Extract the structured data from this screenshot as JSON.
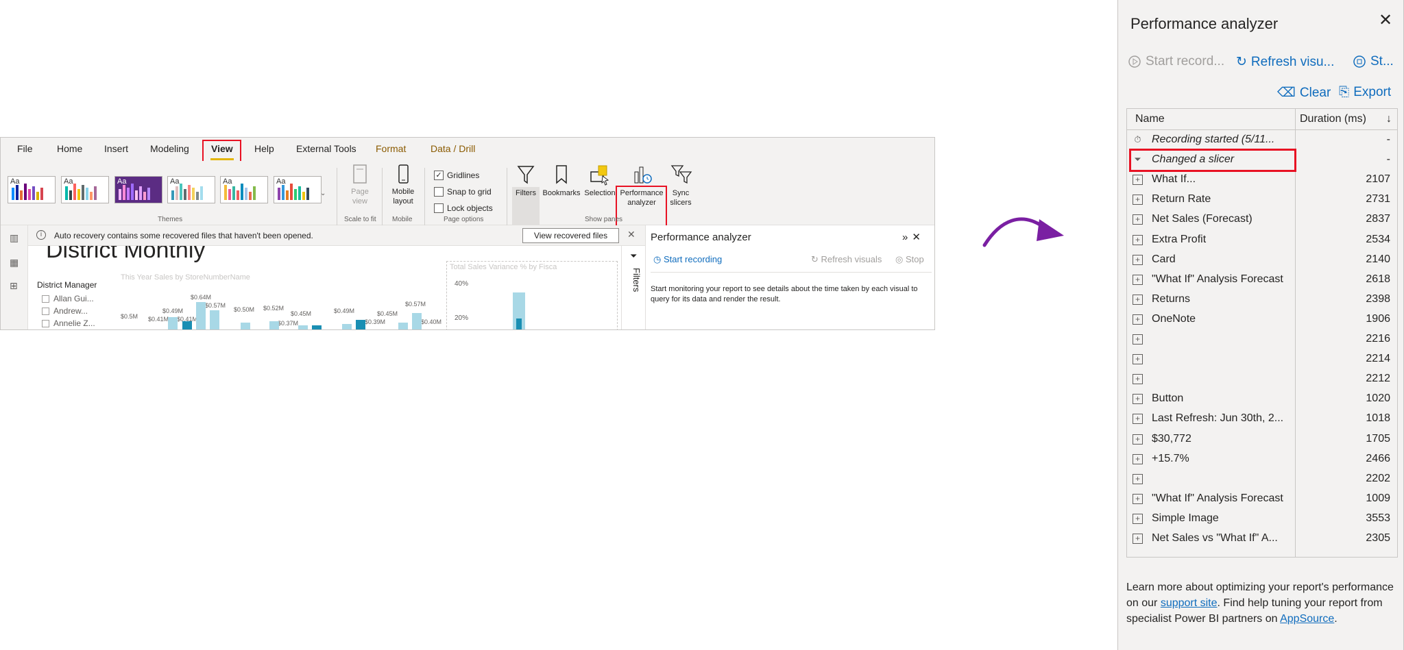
{
  "colors": {
    "accent": "#0f6cbd",
    "highlight": "#e81123",
    "tab_underline": "#e3b505",
    "arrow": "#7a1fa2"
  },
  "ribbon": {
    "menu": [
      {
        "label": "File"
      },
      {
        "label": "Home"
      },
      {
        "label": "Insert"
      },
      {
        "label": "Modeling"
      },
      {
        "label": "View"
      },
      {
        "label": "Help"
      },
      {
        "label": "External Tools"
      },
      {
        "label": "Format"
      },
      {
        "label": "Data / Drill"
      }
    ],
    "theme_aa": "Aa",
    "groups": {
      "themes": "Themes",
      "scale_to_fit": "Scale to fit",
      "mobile": "Mobile",
      "page_options": "Page options",
      "show_panes": "Show panes"
    },
    "buttons": {
      "page_view": "Page view",
      "mobile_layout": "Mobile layout",
      "filters": "Filters",
      "bookmarks": "Bookmarks",
      "selection": "Selection",
      "performance_analyzer": "Performance analyzer",
      "sync_slicers": "Sync slicers"
    },
    "checks": {
      "gridlines": "Gridlines",
      "snap_to_grid": "Snap to grid",
      "lock_objects": "Lock objects"
    }
  },
  "notice": {
    "text": "Auto recovery contains some recovered files that haven't been opened.",
    "button": "View recovered files"
  },
  "report": {
    "title": "District Monthly",
    "chart_title": "This Year Sales by StoreNumberName",
    "slicer_title": "District Manager",
    "slicer_items": [
      "Allan Gui...",
      "Andrew...",
      "Annelie Z..."
    ],
    "bar_labels": [
      "$0.64M",
      "$0.57M",
      "$0.49M",
      "$0.41M",
      "$0.41M",
      "$0.5M",
      "$0.50M",
      "$0.52M",
      "$0.45M",
      "$0.37M",
      "$0.49M",
      "$0.45M",
      "$0.39M",
      "$0.57M",
      "$0.40M"
    ],
    "chart2_title": "Total Sales Variance % by Fisca",
    "chart2_ticks": [
      "40%",
      "20%"
    ],
    "filters_tab": "Filters"
  },
  "pa_mini": {
    "title": "Performance analyzer",
    "start": "Start recording",
    "refresh": "Refresh visuals",
    "stop": "Stop",
    "description": "Start monitoring your report to see details about the time taken by each visual to query for its data and render the result."
  },
  "pa": {
    "title": "Performance analyzer",
    "start": "Start record...",
    "refresh": "Refresh visu...",
    "stop": "St...",
    "clear": "Clear",
    "export": "Export",
    "col_name": "Name",
    "col_duration": "Duration (ms)",
    "rows": [
      {
        "name": "Recording started (5/11...",
        "duration": "-",
        "kind": "timer"
      },
      {
        "name": "Changed a slicer",
        "duration": "-",
        "kind": "filter"
      },
      {
        "name": "What If...",
        "duration": "2107",
        "kind": "plus"
      },
      {
        "name": "Return Rate",
        "duration": "2731",
        "kind": "plus"
      },
      {
        "name": "Net Sales (Forecast)",
        "duration": "2837",
        "kind": "plus"
      },
      {
        "name": "Extra Profit",
        "duration": "2534",
        "kind": "plus"
      },
      {
        "name": "Card",
        "duration": "2140",
        "kind": "plus"
      },
      {
        "name": "\"What If\" Analysis Forecast",
        "duration": "2618",
        "kind": "plus"
      },
      {
        "name": "Returns",
        "duration": "2398",
        "kind": "plus"
      },
      {
        "name": "OneNote",
        "duration": "1906",
        "kind": "plus"
      },
      {
        "name": "",
        "duration": "2216",
        "kind": "plus"
      },
      {
        "name": "",
        "duration": "2214",
        "kind": "plus"
      },
      {
        "name": "",
        "duration": "2212",
        "kind": "plus"
      },
      {
        "name": "Button",
        "duration": "1020",
        "kind": "plus"
      },
      {
        "name": "Last Refresh: Jun 30th, 2...",
        "duration": "1018",
        "kind": "plus"
      },
      {
        "name": "$30,772",
        "duration": "1705",
        "kind": "plus"
      },
      {
        "name": "+15.7%",
        "duration": "2466",
        "kind": "plus"
      },
      {
        "name": "",
        "duration": "2202",
        "kind": "plus"
      },
      {
        "name": "\"What If\" Analysis Forecast",
        "duration": "1009",
        "kind": "plus"
      },
      {
        "name": "Simple Image",
        "duration": "3553",
        "kind": "plus"
      },
      {
        "name": "Net Sales vs \"What If\" A...",
        "duration": "2305",
        "kind": "plus"
      }
    ],
    "footer": {
      "pre": "Learn more about optimizing your report's performance on our ",
      "link1": "support site",
      "mid": ". Find help tuning your report from specialist Power BI partners on ",
      "link2": "AppSource",
      "post": "."
    }
  }
}
